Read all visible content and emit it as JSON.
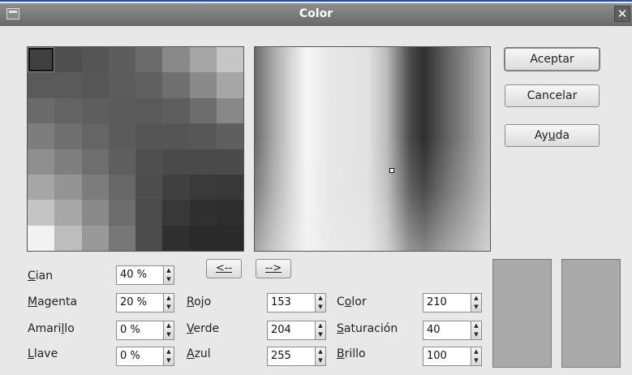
{
  "window": {
    "title": "Color",
    "close_glyph": "✕"
  },
  "buttons": {
    "accept": "Aceptar",
    "cancel": "Cancelar",
    "help": "Ayuda",
    "to_left": "<--",
    "to_right": "-->"
  },
  "palette": {
    "columns": 8,
    "rows": 8,
    "selected_index": 0,
    "cells": [
      "#404040",
      "#4f4f4f",
      "#555555",
      "#5d5d5d",
      "#6b6b6b",
      "#898989",
      "#a5a5a5",
      "#c6c6c6",
      "#5a5a5a",
      "#5a5a5a",
      "#575757",
      "#5c5c5c",
      "#606060",
      "#6f6f6f",
      "#8a8a8a",
      "#a6a6a6",
      "#6a6a6a",
      "#636363",
      "#5e5e5e",
      "#5b5b5b",
      "#5a5a5a",
      "#5e5e5e",
      "#6d6d6d",
      "#878787",
      "#7d7d7d",
      "#707070",
      "#656565",
      "#5b5b5b",
      "#555555",
      "#555555",
      "#575757",
      "#5f5f5f",
      "#8f8f8f",
      "#7f7f7f",
      "#6f6f6f",
      "#5f5f5f",
      "#505050",
      "#4a4a4a",
      "#4a4a4a",
      "#4a4a4a",
      "#a6a6a6",
      "#939393",
      "#7c7c7c",
      "#676767",
      "#4e4e4e",
      "#404040",
      "#3a3a3a",
      "#383838",
      "#c4c4c4",
      "#a8a8a8",
      "#8a8a8a",
      "#6d6d6d",
      "#4b4b4b",
      "#383838",
      "#303030",
      "#2d2d2d",
      "#f2f2f2",
      "#bdbdbd",
      "#999999",
      "#777777",
      "#4b4b4b",
      "#2f2f2f",
      "#2a2a2a",
      "#2a2a2a"
    ]
  },
  "cmyk": {
    "cyan": {
      "label_first": "C",
      "label_rest": "ian",
      "value": "40 %"
    },
    "magenta": {
      "label_first": "M",
      "label_rest": "agenta",
      "value": "20 %"
    },
    "yellow": {
      "label_pre": "Amari",
      "label_mnemonic": "l",
      "label_post": "lo",
      "value": "0 %"
    },
    "key": {
      "label_first": "L",
      "label_rest": "lave",
      "value": "0 %"
    }
  },
  "rgb": {
    "red": {
      "label_first": "R",
      "label_rest": "ojo",
      "value": "153"
    },
    "green": {
      "label_first": "V",
      "label_rest": "erde",
      "value": "204"
    },
    "blue": {
      "label_first": "A",
      "label_rest": "zul",
      "value": "255"
    }
  },
  "hsb": {
    "hue": {
      "label_pre": "C",
      "label_mnemonic": "o",
      "label_post": "lor",
      "value": "210"
    },
    "saturation": {
      "label_first": "S",
      "label_rest": "aturación",
      "value": "40"
    },
    "brightness": {
      "label_first": "B",
      "label_rest": "rillo",
      "value": "100"
    }
  },
  "help_label": {
    "pre": "Ay",
    "mnemonic": "u",
    "post": "da"
  },
  "preview": {
    "original_color": "#a9a9a9",
    "new_color": "#a9a9a9"
  }
}
